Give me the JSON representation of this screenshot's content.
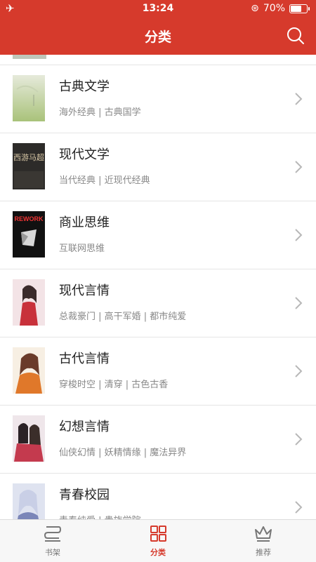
{
  "status_bar": {
    "time": "13:24",
    "battery": "70%",
    "battery_level": 0.7
  },
  "header": {
    "title": "分类"
  },
  "categories": [
    {
      "title": "古典文学",
      "tags": "海外经典 | 古典国学"
    },
    {
      "title": "现代文学",
      "tags": "当代经典 | 近现代经典"
    },
    {
      "title": "商业思维",
      "tags": "互联网思维"
    },
    {
      "title": "现代言情",
      "tags": "总裁豪门 | 高干军婚 | 都市纯爱"
    },
    {
      "title": "古代言情",
      "tags": "穿梭时空 | 清穿 | 古色古香"
    },
    {
      "title": "幻想言情",
      "tags": "仙侠幻情 | 妖精情缘 | 魔法异界"
    },
    {
      "title": "青春校园",
      "tags": "青春纯爱 | 贵族学院"
    }
  ],
  "covers": {
    "modern_lit_text": "西游马超",
    "business_text": "REWORK"
  },
  "tabbar": [
    {
      "label": "书架",
      "active": false
    },
    {
      "label": "分类",
      "active": true
    },
    {
      "label": "推荐",
      "active": false
    }
  ],
  "colors": {
    "accent": "#d63a2c",
    "divider": "#e5e5e5",
    "subtext": "#888888"
  }
}
